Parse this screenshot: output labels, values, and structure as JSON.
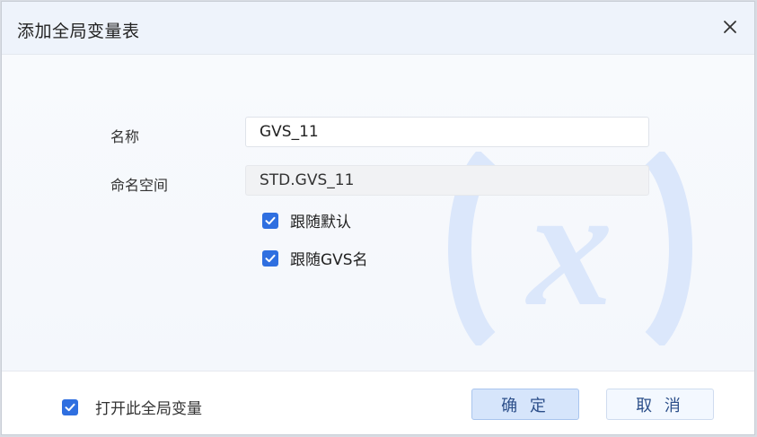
{
  "dialog": {
    "title": "添加全局变量表",
    "close_icon": "close-icon"
  },
  "form": {
    "name_label": "名称",
    "name_value": "GVS_11",
    "namespace_label": "命名空间",
    "namespace_value": "STD.GVS_11",
    "follow_default": {
      "label": "跟随默认",
      "checked": true
    },
    "follow_gvs_name": {
      "label": "跟随GVS名",
      "checked": true
    },
    "watermark_icon": "function-x-icon"
  },
  "footer": {
    "enable_checkbox": {
      "label": "打开此全局变量",
      "checked": true
    },
    "confirm_label": "确 定",
    "cancel_label": "取 消"
  },
  "colors": {
    "accent": "#2f6fe0",
    "header_bg": "#eef3fb",
    "primary_button_bg": "#d6e5fb",
    "watermark": "#dbe7fb"
  }
}
